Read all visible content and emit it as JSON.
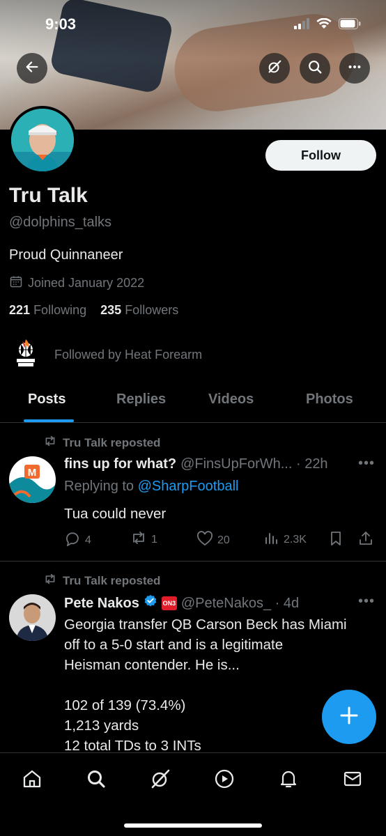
{
  "status_bar": {
    "time": "9:03"
  },
  "profile": {
    "name": "Tru Talk",
    "handle": "@dolphins_talks",
    "bio": "Proud Quinnaneer",
    "joined": "Joined January 2022",
    "following_count": "221",
    "following_label": "Following",
    "followers_count": "235",
    "followers_label": "Followers",
    "followed_by": "Followed by Heat Forearm",
    "follow_button": "Follow"
  },
  "tabs": [
    {
      "label": "Posts",
      "active": true
    },
    {
      "label": "Replies",
      "active": false
    },
    {
      "label": "Videos",
      "active": false
    },
    {
      "label": "Photos",
      "active": false
    }
  ],
  "posts": [
    {
      "repost_label": "Tru Talk reposted",
      "author": "fins up for what?",
      "meta": "@FinsUpForWh... · 22h",
      "replying_prefix": "Replying to ",
      "replying_to": "@SharpFootball",
      "text": "Tua could never",
      "replies": "4",
      "reposts": "1",
      "likes": "20",
      "views": "2.3K"
    },
    {
      "repost_label": "Tru Talk reposted",
      "author": "Pete Nakos",
      "badge": "ON3",
      "meta": "@PeteNakos_ · 4d",
      "text_lines": [
        "Georgia transfer QB Carson Beck has Miami",
        "off to a 5-0 start and is a legitimate",
        "Heisman contender. He is...",
        "",
        "102 of 139 (73.4%)",
        "1,213 yards",
        "12 total TDs to 3 INTs"
      ]
    }
  ],
  "colors": {
    "accent": "#1d9bf0",
    "background": "#000000",
    "muted": "#71767b"
  }
}
